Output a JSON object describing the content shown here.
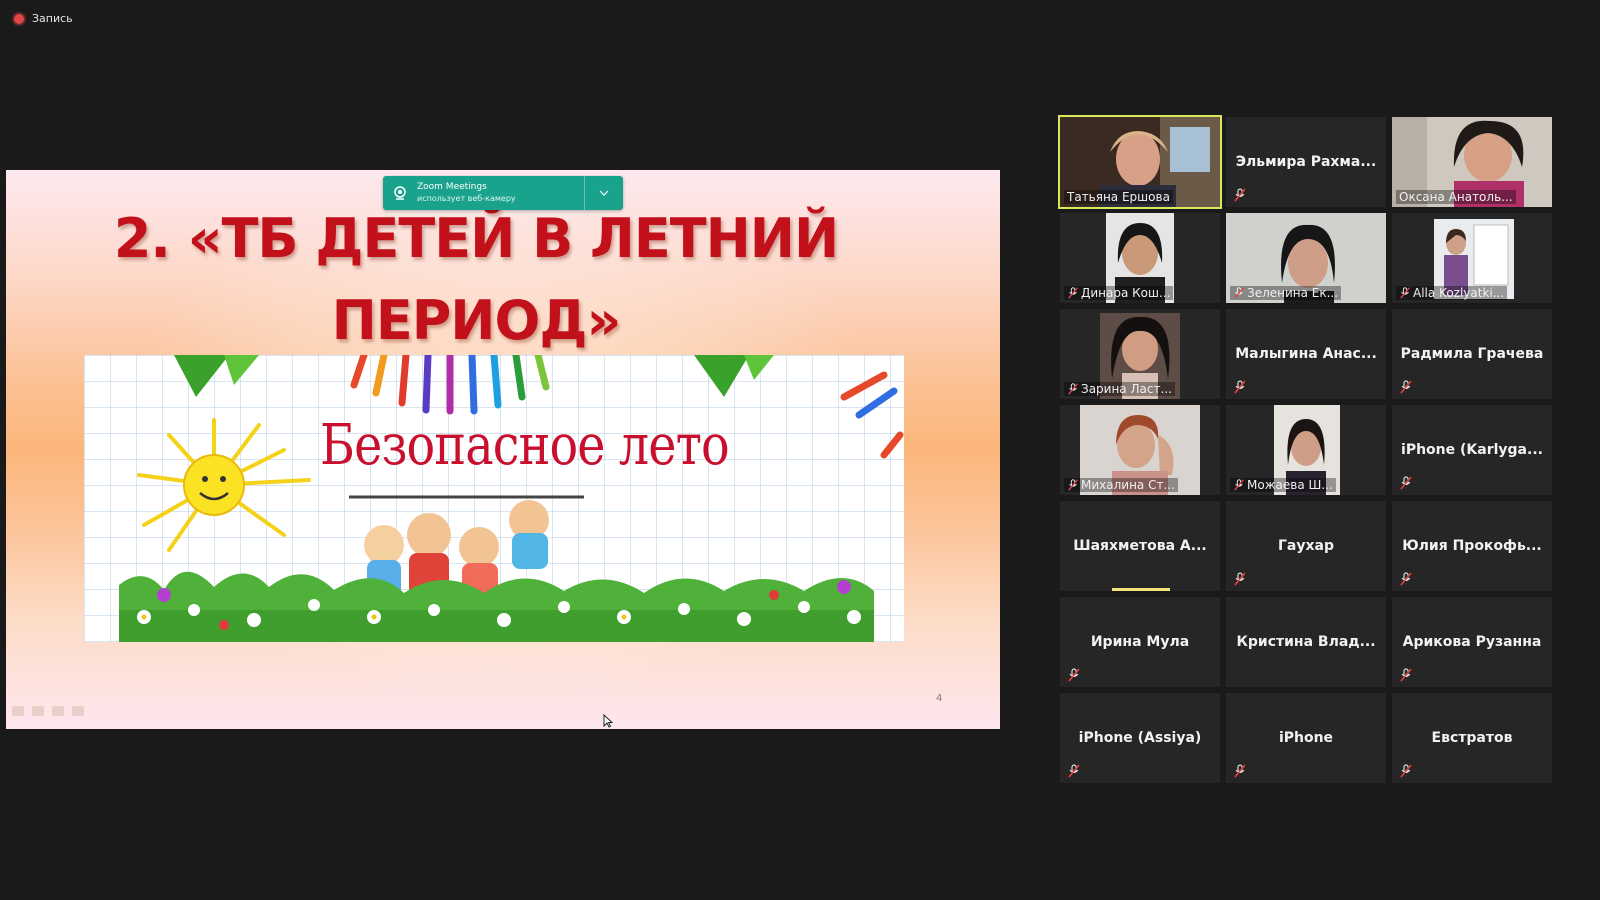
{
  "recording": {
    "label": "Запись",
    "color": "#e04646"
  },
  "notification": {
    "title": "Zoom Meetings",
    "subtitle": "использует веб-камеру",
    "icon": "webcam-icon",
    "toggle_icon": "chevron-down-icon",
    "color": "#19a38c"
  },
  "slide": {
    "title_line1": "2. «ТБ ДЕТЕЙ В ЛЕТНИЙ",
    "title_line2": "ПЕРИОД»",
    "banner_text": "Безопасное лето",
    "page_number": "4",
    "title_color": "#c2111a"
  },
  "gallery": {
    "active_speaker_color": "#d9e85a",
    "participants": [
      {
        "name": "Татьяна Ершова",
        "video": true,
        "muted": false,
        "active": true
      },
      {
        "name": "Эльмира  Рахма...",
        "video": false,
        "muted": true
      },
      {
        "name": "Оксана Анатоль...",
        "video": true,
        "muted": false
      },
      {
        "name": "Динара Кош...",
        "video": true,
        "muted": true
      },
      {
        "name": "Зеленина Ек...",
        "video": true,
        "muted": true
      },
      {
        "name": "Alla Kozlyatki...",
        "video": true,
        "muted": true
      },
      {
        "name": "Зарина Ласт...",
        "video": true,
        "muted": true
      },
      {
        "name": "Малыгина  Анас...",
        "video": false,
        "muted": true
      },
      {
        "name": "Радмила Грачева",
        "video": false,
        "muted": true
      },
      {
        "name": "Михалина Ст...",
        "video": true,
        "muted": true
      },
      {
        "name": "Можаева Ш...",
        "video": true,
        "muted": true
      },
      {
        "name": "iPhone  (Karlyga...",
        "video": false,
        "muted": true
      },
      {
        "name": "Шаяхметова  А...",
        "video": false,
        "muted": false,
        "speaking": true
      },
      {
        "name": "Гаухар",
        "video": false,
        "muted": true
      },
      {
        "name": "Юлия  Прокофь...",
        "video": false,
        "muted": true
      },
      {
        "name": "Ирина Мула",
        "video": false,
        "muted": true
      },
      {
        "name": "Кристина  Влад...",
        "video": false,
        "muted": false
      },
      {
        "name": "Арикова Рузанна",
        "video": false,
        "muted": true
      },
      {
        "name": "iPhone (Assiya)",
        "video": false,
        "muted": true
      },
      {
        "name": "iPhone",
        "video": false,
        "muted": true
      },
      {
        "name": "Евстратов",
        "video": false,
        "muted": true
      }
    ]
  }
}
